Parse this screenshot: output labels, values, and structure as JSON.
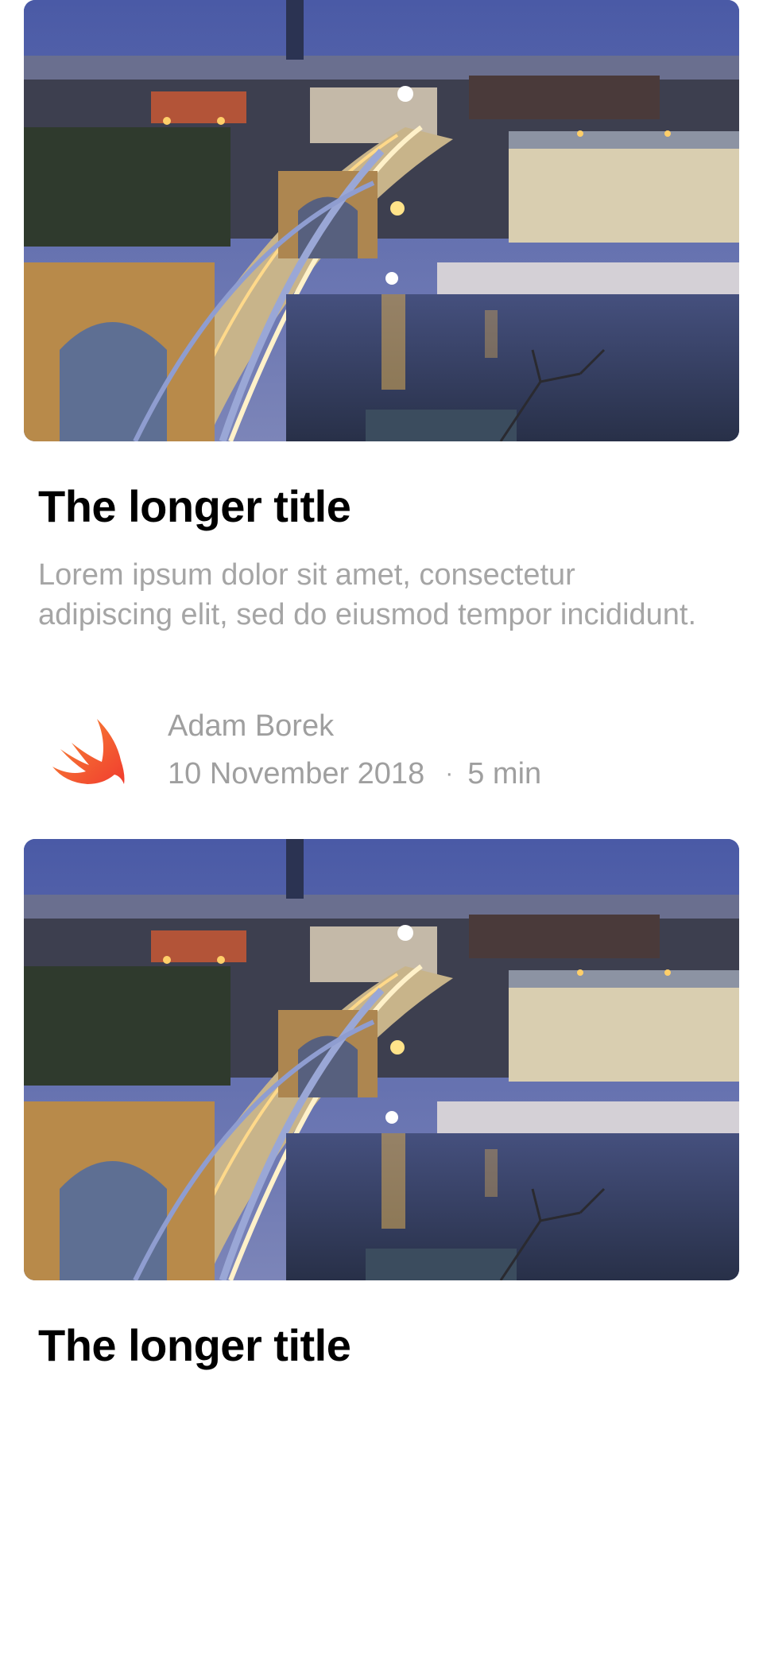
{
  "colors": {
    "title": "#000000",
    "body_text": "#a5a5a5",
    "meta_text": "#9f9f9f",
    "swift_orange": "#f05138",
    "sky": "#4f5fa5"
  },
  "articles": [
    {
      "image_icon": "city-bridge-night-photo",
      "title": "The longer title",
      "body": "Lorem ipsum dolor sit amet, consectetur adipiscing elit, sed do eiusmod tempor incididunt.",
      "author_icon": "swift-logo-icon",
      "author": "Adam Borek",
      "date": "10 November 2018",
      "separator": "·",
      "read_time": "5 min"
    },
    {
      "image_icon": "city-bridge-night-photo",
      "title": "The longer title"
    }
  ]
}
